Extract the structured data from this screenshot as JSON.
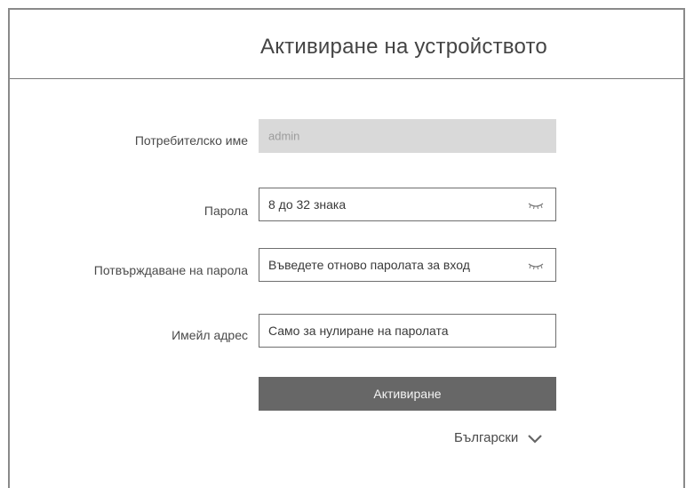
{
  "header": {
    "title": "Активиране на устройството"
  },
  "form": {
    "username": {
      "label": "Потребителско име",
      "value": "admin"
    },
    "password": {
      "label": "Парола",
      "placeholder": "8 до 32 знака"
    },
    "confirm_password": {
      "label": "Потвърждаване на парола",
      "placeholder": "Въведете отново паролата за вход"
    },
    "email": {
      "label": "Имейл адрес",
      "placeholder": "Само за нулиране на паролата"
    },
    "submit_label": "Активиране"
  },
  "language": {
    "selected": "Български"
  },
  "icons": {
    "password_toggle": "eye-closed-icon",
    "language_dropdown": "chevron-down-icon"
  },
  "colors": {
    "button_bg": "#676767",
    "disabled_field_bg": "#d9d9d9",
    "border": "#6f6f6f"
  }
}
